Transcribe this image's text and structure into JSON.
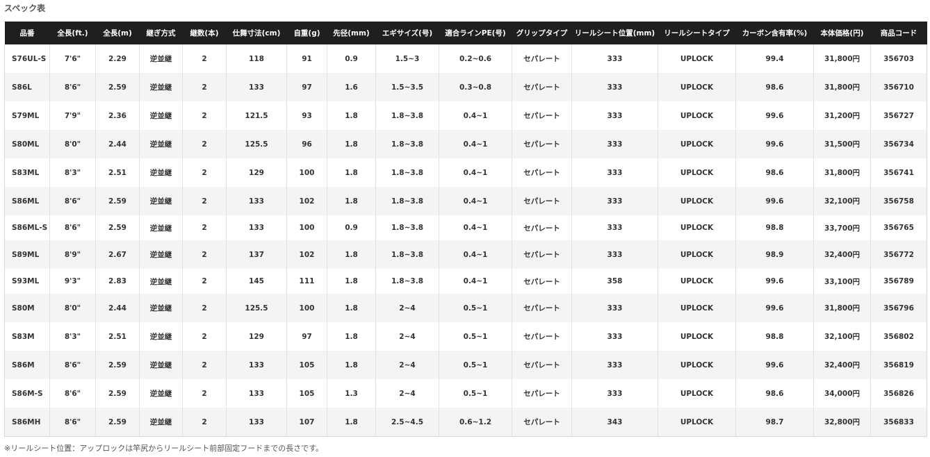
{
  "page": {
    "title": "スペック表",
    "footnote": "※リールシート位置：アップロックは竿尻からリールシート前部固定フードまでの長さです。"
  },
  "table": {
    "headers": [
      "品番",
      "全長(ft.)",
      "全長(m)",
      "継ぎ方式",
      "継数(本)",
      "仕舞寸法(cm)",
      "自重(g)",
      "先径(mm)",
      "エギサイズ(号)",
      "適合ラインPE(号)",
      "グリップタイプ",
      "リールシート位置(mm)",
      "リールシートタイプ",
      "カーボン含有率(%)",
      "本体価格(円)",
      "商品コード"
    ],
    "rows": [
      [
        "S76UL-S",
        "7'6\"",
        "2.29",
        "逆並継",
        "2",
        "118",
        "91",
        "0.9",
        "1.5~3",
        "0.2~0.6",
        "セパレート",
        "333",
        "UPLOCK",
        "99.4",
        "31,800円",
        "356703"
      ],
      [
        "S86L",
        "8'6\"",
        "2.59",
        "逆並継",
        "2",
        "133",
        "97",
        "1.6",
        "1.5~3.5",
        "0.3~0.8",
        "セパレート",
        "333",
        "UPLOCK",
        "98.6",
        "31,800円",
        "356710"
      ],
      [
        "S79ML",
        "7'9\"",
        "2.36",
        "逆並継",
        "2",
        "121.5",
        "93",
        "1.8",
        "1.8~3.8",
        "0.4~1",
        "セパレート",
        "333",
        "UPLOCK",
        "99.6",
        "31,200円",
        "356727"
      ],
      [
        "S80ML",
        "8'0\"",
        "2.44",
        "逆並継",
        "2",
        "125.5",
        "96",
        "1.8",
        "1.8~3.8",
        "0.4~1",
        "セパレート",
        "333",
        "UPLOCK",
        "99.6",
        "31,500円",
        "356734"
      ],
      [
        "S83ML",
        "8'3\"",
        "2.51",
        "逆並継",
        "2",
        "129",
        "100",
        "1.8",
        "1.8~3.8",
        "0.4~1",
        "セパレート",
        "333",
        "UPLOCK",
        "98.6",
        "31,800円",
        "356741"
      ],
      [
        "S86ML",
        "8'6\"",
        "2.59",
        "逆並継",
        "2",
        "133",
        "102",
        "1.8",
        "1.8~3.8",
        "0.4~1",
        "セパレート",
        "333",
        "UPLOCK",
        "99.6",
        "32,100円",
        "356758"
      ],
      [
        "S86ML-S",
        "8'6\"",
        "2.59",
        "逆並継",
        "2",
        "133",
        "100",
        "0.9",
        "1.8~3.8",
        "0.4~1",
        "セパレート",
        "333",
        "UPLOCK",
        "98.8",
        "33,700円",
        "356765"
      ],
      [
        "S89ML",
        "8'9\"",
        "2.67",
        "逆並継",
        "2",
        "137",
        "102",
        "1.8",
        "1.8~3.8",
        "0.4~1",
        "セパレート",
        "333",
        "UPLOCK",
        "98.9",
        "32,400円",
        "356772"
      ],
      [
        "S93ML",
        "9'3\"",
        "2.83",
        "逆並継",
        "2",
        "145",
        "111",
        "1.8",
        "1.8~3.8",
        "0.4~1",
        "セパレート",
        "358",
        "UPLOCK",
        "99.6",
        "33,100円",
        "356789"
      ],
      [
        "S80M",
        "8'0\"",
        "2.44",
        "逆並継",
        "2",
        "125.5",
        "100",
        "1.8",
        "2~4",
        "0.5~1",
        "セパレート",
        "333",
        "UPLOCK",
        "99.6",
        "31,800円",
        "356796"
      ],
      [
        "S83M",
        "8'3\"",
        "2.51",
        "逆並継",
        "2",
        "129",
        "97",
        "1.8",
        "2~4",
        "0.5~1",
        "セパレート",
        "333",
        "UPLOCK",
        "98.8",
        "32,100円",
        "356802"
      ],
      [
        "S86M",
        "8'6\"",
        "2.59",
        "逆並継",
        "2",
        "133",
        "105",
        "1.8",
        "2~4",
        "0.5~1",
        "セパレート",
        "333",
        "UPLOCK",
        "99.6",
        "32,400円",
        "356819"
      ],
      [
        "S86M-S",
        "8'6\"",
        "2.59",
        "逆並継",
        "2",
        "133",
        "105",
        "1.3",
        "2~4",
        "0.5~1",
        "セパレート",
        "333",
        "UPLOCK",
        "98.6",
        "34,000円",
        "356826"
      ],
      [
        "S86MH",
        "8'6\"",
        "2.59",
        "逆並継",
        "2",
        "133",
        "107",
        "1.8",
        "2.5~4.5",
        "0.6~1.2",
        "セパレート",
        "343",
        "UPLOCK",
        "98.7",
        "32,800円",
        "356833"
      ]
    ]
  },
  "colors": {
    "header_bg": "#1f1f1f",
    "header_text": "#ffffff",
    "row_alt_bg": "#f4f4f4",
    "text": "#333333"
  }
}
